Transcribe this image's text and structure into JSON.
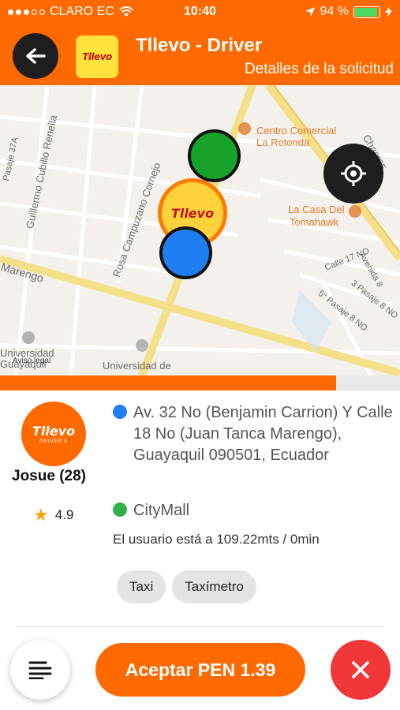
{
  "status_bar": {
    "carrier": "CLARO EC",
    "time": "10:40",
    "battery": "94 %"
  },
  "header": {
    "title": "Tllevo - Driver",
    "subtitle": "Detalles de la solicitud",
    "logo_text": "Tllevo"
  },
  "map": {
    "pin_logo_text": "Tllevo",
    "labels": {
      "centro_comercial": "Centro Comercial",
      "la_rotonda": "La Rotonda",
      "chacras": "Chacras",
      "la_casa_del": "La Casa Del",
      "tomahawk": "Tomahawk",
      "calle17": "Calle 17 NO",
      "avenida8": "Avenida 8",
      "pasaje5": "5° Pasaje 8 NO",
      "pasaje3": "3 Pasaje 8 NO",
      "renella": "Guillermo Cubillo Renella",
      "cornejo": "Rosa Campuzano Cornejo",
      "marengo": "Marengo",
      "pasaje37": "Pasaje 37A",
      "universidad1": "Universidad",
      "guayaquil1": "Guayaquil",
      "aviso_legal": "Aviso legal",
      "universidad2": "Universidad de"
    },
    "colors": {
      "background": "#f4f1ec",
      "major_road": "#f5e08a",
      "street": "#ffffff"
    }
  },
  "progress": {
    "fraction": 0.84,
    "color": "#ff6a00"
  },
  "driver": {
    "avatar_text": "Tllevo",
    "avatar_sub": "DRIVER'S",
    "name": "Josue (28)",
    "rating": "4.9"
  },
  "trip": {
    "origin": "Av. 32 No (Benjamin Carrion) Y Calle 18 No (Juan Tanca Marengo), Guayaquil 090501, Ecuador",
    "destination": "CityMall",
    "distance_text": "El usuario está a 109.22mts / 0min"
  },
  "chips": [
    "Taxi",
    "Taxímetro"
  ],
  "actions": {
    "accept_label": "Aceptar PEN 1.39"
  },
  "colors": {
    "brand": "#ff6a00",
    "dark": "#1e1e1e",
    "cancel": "#f0383a",
    "origin_dot": "#1f7ef0",
    "dest_dot": "#2fb04a"
  },
  "icons": {
    "back": "arrow-left-icon",
    "locate": "crosshair-icon",
    "menu": "menu-lines-icon",
    "close": "close-icon",
    "star": "star-icon"
  }
}
